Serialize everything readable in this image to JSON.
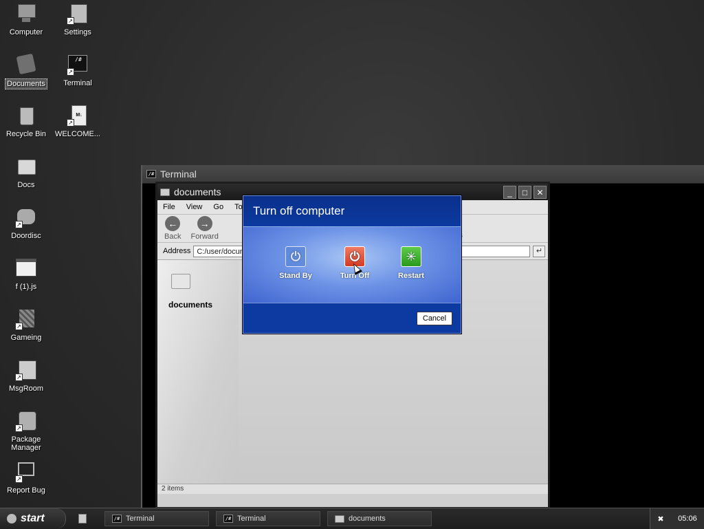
{
  "desktop": {
    "icons": [
      {
        "label": "Computer",
        "icon": "computer-icon"
      },
      {
        "label": "Settings",
        "icon": "settings-icon"
      },
      {
        "label": "Documents",
        "icon": "documents-icon"
      },
      {
        "label": "Terminal",
        "icon": "terminal-icon"
      },
      {
        "label": "Recycle Bin",
        "icon": "recycle-bin-icon"
      },
      {
        "label": "WELCOME...",
        "icon": "markdown-file-icon"
      },
      {
        "label": "Docs",
        "icon": "folder-icon"
      },
      {
        "label": "Doordisc",
        "icon": "discord-icon"
      },
      {
        "label": "f (1).js",
        "icon": "js-file-icon"
      },
      {
        "label": "Gameing",
        "icon": "game-icon"
      },
      {
        "label": "MsgRoom",
        "icon": "msgroom-icon"
      },
      {
        "label": "Package Manager",
        "icon": "package-manager-icon"
      },
      {
        "label": "Report Bug",
        "icon": "report-bug-icon"
      }
    ]
  },
  "terminal_window": {
    "title": "Terminal",
    "icon_text": "/#"
  },
  "explorer": {
    "title": "documents",
    "menu": [
      "File",
      "View",
      "Go",
      "To"
    ],
    "toolbar": {
      "back": "Back",
      "forward": "Forward",
      "partial": "s"
    },
    "address_label": "Address",
    "address_value": "C:/user/docum",
    "go_symbol": "↵",
    "controls": {
      "minimize": "_",
      "maximize": "□",
      "close": "✕"
    },
    "folder_name": "documents",
    "status": "2 items"
  },
  "dialog": {
    "title": "Turn off computer",
    "options": {
      "standby": "Stand By",
      "turnoff": "Turn Off",
      "restart": "Restart"
    },
    "glyphs": {
      "standby": "⏻",
      "turnoff": "⏻",
      "restart": "✳"
    },
    "cancel": "Cancel"
  },
  "taskbar": {
    "start": "start",
    "tasks": [
      "Terminal",
      "Terminal",
      "documents"
    ],
    "clock": "05:06",
    "tray_icon": "✖"
  },
  "colors": {
    "dialog_blue": "#0c3aa0",
    "turnoff_red": "#d23a24",
    "restart_green": "#2a9a1c"
  }
}
